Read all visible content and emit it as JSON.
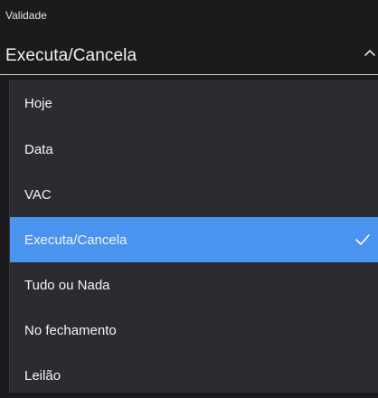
{
  "field": {
    "label": "Validade",
    "value": "Executa/Cancela",
    "expanded": true
  },
  "icons": {
    "chevron": "chevron-up-icon",
    "check": "checkmark-icon"
  },
  "colors": {
    "background": "#1b1b1d",
    "menu_background": "#2c2c30",
    "selected_background": "#4a94f0"
  },
  "options": [
    {
      "label": "Hoje",
      "selected": false
    },
    {
      "label": "Data",
      "selected": false
    },
    {
      "label": "VAC",
      "selected": false
    },
    {
      "label": "Executa/Cancela",
      "selected": true
    },
    {
      "label": "Tudo ou Nada",
      "selected": false
    },
    {
      "label": "No fechamento",
      "selected": false
    },
    {
      "label": "Leilão",
      "selected": false
    }
  ]
}
